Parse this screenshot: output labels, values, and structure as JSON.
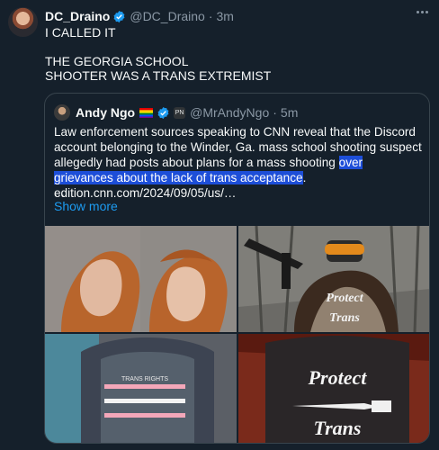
{
  "post": {
    "author_name": "DC_Draino",
    "author_handle": "@DC_Draino",
    "dot": "·",
    "time": "3m",
    "text_line1": "I CALLED IT",
    "text_line2": "THE GEORGIA SCHOOL",
    "text_line3": "SHOOTER WAS A TRANS EXTREMIST"
  },
  "quote": {
    "author_name": "Andy Ngo",
    "affiliate_badge": "PN",
    "author_handle": "@MrAndyNgo",
    "dot": "·",
    "time": "5m",
    "text_before": "Law enforcement sources speaking to CNN reveal that the Discord account belonging to the Winder, Ga. mass school shooting suspect allegedly had posts about plans for a mass shooting ",
    "text_highlight": "over grievances about the lack of trans acceptance",
    "text_after": ". edition.cnn.com/2024/09/05/us/…",
    "ellipsis": "...",
    "show_more": "Show more",
    "images": {
      "shirt1_title": "TRANS RIGHTS",
      "shirt2_line1": "Protect",
      "shirt2_line2": "Trans",
      "shirt3_line1": "Protect",
      "shirt3_line2": "Trans"
    }
  },
  "colors": {
    "background": "#15202b",
    "verified": "#1d9bf0",
    "link": "#1d9bf0",
    "highlight": "#1d4ed8",
    "muted": "#8b98a5"
  }
}
